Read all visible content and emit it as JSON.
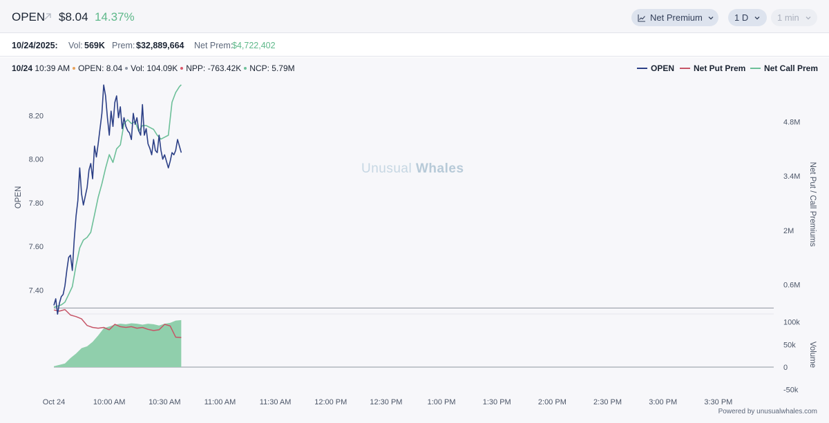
{
  "header": {
    "ticker": "OPEN",
    "price": "$8.04",
    "change_pct": "14.37%",
    "metric_selector": "Net Premium",
    "range_selector": "1 D",
    "interval_selector": "1 min"
  },
  "stats": {
    "date": "10/24/2025:",
    "vol_label": "Vol:",
    "vol_value": "569K",
    "prem_label": "Prem:",
    "prem_value": "$32,889,664",
    "netprem_label": "Net Prem:",
    "netprem_value": "$4,722,402"
  },
  "crosshair": {
    "date": "10/24",
    "time": "10:39 AM",
    "open_label": "OPEN:",
    "open_value": "8.04",
    "vol_label": "Vol:",
    "vol_value": "104.09K",
    "npp_label": "NPP:",
    "npp_value": "-763.42K",
    "ncp_label": "NCP:",
    "ncp_value": "5.79M"
  },
  "watermark": {
    "part1": "Unusual",
    "part2": "Whales"
  },
  "footer": "Powered by unusualwhales.com",
  "icons": {
    "ticker_link": "arrow-up-right-icon",
    "metric": "line-chart-icon",
    "dropdown": "chevron-down-icon"
  },
  "colors": {
    "open": "#2b3f86",
    "net_put": "#c65466",
    "net_call": "#6cbf98",
    "volume_fill": "#90cfac",
    "positive": "#5eb88a",
    "dot_orange": "#e8a25a",
    "dot_red": "#d9576a",
    "dot_green": "#6cbf98"
  },
  "chart_data": {
    "type": "line",
    "x_tick_labels": [
      "Oct 24",
      "10:00 AM",
      "10:30 AM",
      "11:00 AM",
      "11:30 AM",
      "12:00 PM",
      "12:30 PM",
      "1:00 PM",
      "1:30 PM",
      "2:00 PM",
      "2:30 PM",
      "3:00 PM",
      "3:30 PM"
    ],
    "x_tick_minutes": [
      570,
      600,
      630,
      660,
      690,
      720,
      750,
      780,
      810,
      840,
      870,
      900,
      930
    ],
    "x_range_minutes": [
      570,
      960
    ],
    "left_axis": {
      "label": "OPEN",
      "ticks": [
        "7.40",
        "7.60",
        "7.80",
        "8.00",
        "8.20"
      ],
      "tick_values": [
        7.4,
        7.6,
        7.8,
        8.0,
        8.2
      ],
      "range": [
        7.3,
        8.35
      ]
    },
    "right_axis": {
      "label": "Net Put / Call Premiums",
      "ticks": [
        "0.6M",
        "2M",
        "3.4M",
        "4.8M"
      ],
      "tick_values": [
        0.6,
        2.0,
        3.4,
        4.8
      ],
      "range": [
        -0.1,
        5.8
      ],
      "unit": "M"
    },
    "volume_axis": {
      "label": "Volume",
      "ticks": [
        "100k",
        "50k",
        "0",
        "-50k"
      ],
      "tick_values": [
        100,
        50,
        0,
        -50
      ],
      "range": [
        -55,
        110
      ],
      "unit": "k"
    },
    "legend": [
      "OPEN",
      "Net Put Prem",
      "Net Call Prem"
    ],
    "series": [
      {
        "name": "OPEN",
        "axis": "left",
        "x": [
          570,
          571,
          572,
          573,
          574,
          575,
          576,
          577,
          578,
          579,
          580,
          581,
          582,
          583,
          584,
          585,
          586,
          587,
          588,
          589,
          590,
          591,
          592,
          593,
          594,
          595,
          596,
          597,
          598,
          599,
          600,
          601,
          602,
          603,
          604,
          605,
          606,
          607,
          608,
          609,
          610,
          611,
          612,
          613,
          614,
          615,
          616,
          617,
          618,
          619,
          620,
          621,
          622,
          623,
          624,
          625,
          626,
          627,
          628,
          629,
          630,
          631,
          632,
          633,
          634,
          635,
          636,
          637,
          638,
          639
        ],
        "values": [
          7.33,
          7.36,
          7.29,
          7.34,
          7.37,
          7.38,
          7.42,
          7.49,
          7.55,
          7.56,
          7.49,
          7.63,
          7.74,
          7.81,
          7.96,
          7.84,
          7.79,
          7.83,
          7.87,
          7.95,
          7.98,
          7.91,
          8.06,
          8.01,
          8.07,
          8.14,
          8.21,
          8.34,
          8.29,
          8.19,
          8.11,
          8.22,
          8.15,
          8.26,
          8.29,
          8.19,
          8.24,
          8.14,
          8.19,
          8.15,
          8.13,
          8.12,
          8.09,
          8.21,
          8.16,
          8.19,
          8.13,
          8.11,
          8.25,
          8.11,
          8.14,
          8.07,
          8.05,
          8.02,
          8.09,
          8.04,
          8.03,
          8.11,
          8.04,
          8.0,
          8.02,
          7.99,
          7.96,
          7.99,
          8.03,
          8.02,
          8.04,
          8.09,
          8.06,
          8.03
        ]
      },
      {
        "name": "Net Put Prem",
        "axis": "right",
        "x": [
          570,
          573,
          576,
          579,
          582,
          585,
          588,
          591,
          594,
          597,
          600,
          603,
          606,
          609,
          612,
          615,
          618,
          621,
          624,
          627,
          630,
          633,
          636,
          639
        ],
        "values": [
          -0.05,
          -0.08,
          -0.04,
          -0.18,
          -0.22,
          -0.28,
          -0.45,
          -0.5,
          -0.52,
          -0.5,
          -0.56,
          -0.42,
          -0.48,
          -0.5,
          -0.48,
          -0.52,
          -0.5,
          -0.55,
          -0.58,
          -0.56,
          -0.42,
          -0.46,
          -0.75,
          -0.76
        ]
      },
      {
        "name": "Net Call Prem",
        "axis": "right",
        "x": [
          570,
          572,
          574,
          576,
          578,
          580,
          582,
          584,
          586,
          588,
          590,
          592,
          594,
          596,
          598,
          600,
          602,
          604,
          606,
          608,
          610,
          612,
          614,
          616,
          618,
          620,
          622,
          624,
          626,
          628,
          630,
          632,
          634,
          636,
          638,
          639
        ],
        "values": [
          0.02,
          0.05,
          0.08,
          0.15,
          0.35,
          0.55,
          1.1,
          1.55,
          1.75,
          1.82,
          1.95,
          2.4,
          2.85,
          3.2,
          3.6,
          3.95,
          3.75,
          4.1,
          4.2,
          4.75,
          4.85,
          4.75,
          4.8,
          4.55,
          4.7,
          4.7,
          4.65,
          4.6,
          4.45,
          4.35,
          4.4,
          4.45,
          5.3,
          5.55,
          5.7,
          5.75
        ]
      },
      {
        "name": "Volume",
        "axis": "volume",
        "x": [
          570,
          573,
          576,
          579,
          582,
          585,
          588,
          591,
          594,
          597,
          600,
          603,
          606,
          609,
          612,
          615,
          618,
          621,
          624,
          627,
          630,
          633,
          636,
          639
        ],
        "values": [
          2,
          5,
          8,
          20,
          30,
          42,
          46,
          56,
          70,
          86,
          90,
          94,
          96,
          95,
          97,
          96,
          94,
          96,
          95,
          92,
          96,
          98,
          103,
          104
        ]
      }
    ]
  }
}
